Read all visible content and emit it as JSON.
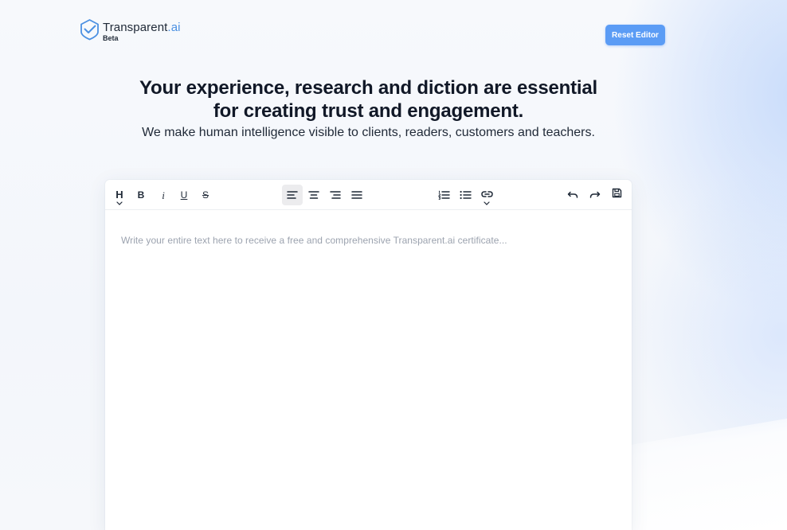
{
  "brand": {
    "name_main": "Transparent",
    "name_accent": ".ai",
    "badge": "Beta",
    "accent_color": "#4b90e2"
  },
  "header": {
    "reset_label": "Reset Editor",
    "reset_color": "#5b9cf5"
  },
  "hero": {
    "title_line1": "Your experience, research and diction are essential",
    "title_line2": "for creating trust and engagement.",
    "subtitle": "We make human intelligence visible to clients, readers, customers and teachers."
  },
  "toolbar": {
    "heading_label": "H",
    "bold_label": "B",
    "italic_label": "i",
    "underline_label": "U",
    "strikethrough_label": "S",
    "icons": [
      "heading-icon",
      "bold-icon",
      "italic-icon",
      "underline-icon",
      "strikethrough-icon",
      "align-left-icon",
      "align-center-icon",
      "align-right-icon",
      "align-justify-icon",
      "ordered-list-icon",
      "bullet-list-icon",
      "link-icon",
      "undo-icon",
      "redo-icon",
      "save-icon"
    ],
    "active_alignment": "left"
  },
  "editor": {
    "placeholder": "Write your entire text here to receive a free and comprehensive Transparent.ai certificate..."
  }
}
